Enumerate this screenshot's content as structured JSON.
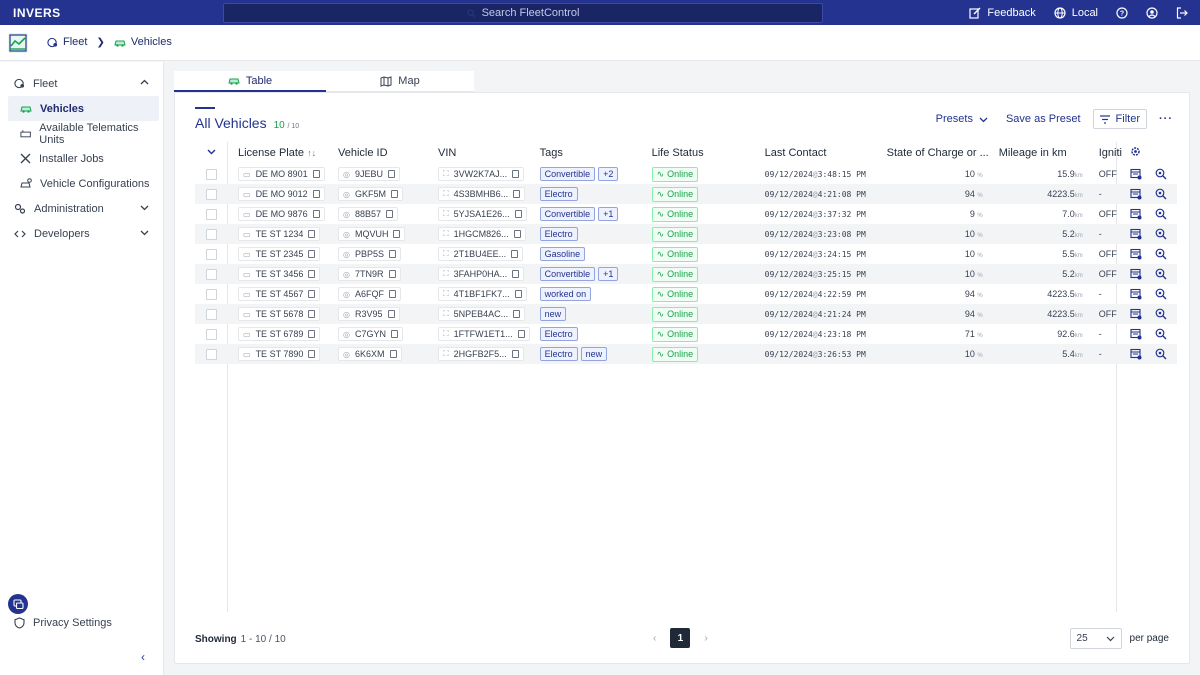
{
  "topbar": {
    "logo": "INVERS",
    "search_placeholder": "Search FleetControl",
    "feedback": "Feedback",
    "locale": "Local"
  },
  "breadcrumb": {
    "fleet": "Fleet",
    "vehicles": "Vehicles"
  },
  "sidebar": {
    "fleet": "Fleet",
    "items": [
      "Vehicles",
      "Available Telematics Units",
      "Installer Jobs",
      "Vehicle Configurations"
    ],
    "administration": "Administration",
    "developers": "Developers",
    "privacy": "Privacy Settings"
  },
  "tabs": {
    "table": "Table",
    "map": "Map"
  },
  "list": {
    "title": "All Vehicles",
    "count": "10",
    "total": "/ 10",
    "presets": "Presets",
    "save_preset": "Save as Preset",
    "filter": "Filter",
    "more": "···"
  },
  "columns": {
    "license_plate": "License Plate",
    "vehicle_id": "Vehicle ID",
    "vin": "VIN",
    "tags": "Tags",
    "life_status": "Life Status",
    "last_contact": "Last Contact",
    "soc": "State of Charge or ...",
    "mileage": "Mileage in km",
    "ignition": "Igniti"
  },
  "rows": [
    {
      "plate": "DE MO 8901",
      "vid": "9JEBU",
      "vin": "3VW2K7AJ...",
      "tags": [
        "Convertible",
        "+2"
      ],
      "status": "Online",
      "contact": "09/12/2024@3:48:15 PM",
      "soc": "10",
      "mileage": "15.9",
      "ign": "OFF"
    },
    {
      "plate": "DE MO 9012",
      "vid": "GKF5M",
      "vin": "4S3BMHB6...",
      "tags": [
        "Electro"
      ],
      "status": "Online",
      "contact": "09/12/2024@4:21:08 PM",
      "soc": "94",
      "mileage": "4223.5",
      "ign": "-"
    },
    {
      "plate": "DE MO 9876",
      "vid": "88B57",
      "vin": "5YJSA1E26...",
      "tags": [
        "Convertible",
        "+1"
      ],
      "status": "Online",
      "contact": "09/12/2024@3:37:32 PM",
      "soc": "9",
      "mileage": "7.0",
      "ign": "OFF"
    },
    {
      "plate": "TE ST 1234",
      "vid": "MQVUH",
      "vin": "1HGCM826...",
      "tags": [
        "Electro"
      ],
      "status": "Online",
      "contact": "09/12/2024@3:23:08 PM",
      "soc": "10",
      "mileage": "5.2",
      "ign": "-"
    },
    {
      "plate": "TE ST 2345",
      "vid": "PBP5S",
      "vin": "2T1BU4EE...",
      "tags": [
        "Gasoline"
      ],
      "status": "Online",
      "contact": "09/12/2024@3:24:15 PM",
      "soc": "10",
      "mileage": "5.5",
      "ign": "OFF"
    },
    {
      "plate": "TE ST 3456",
      "vid": "7TN9R",
      "vin": "3FAHP0HA...",
      "tags": [
        "Convertible",
        "+1"
      ],
      "status": "Online",
      "contact": "09/12/2024@3:25:15 PM",
      "soc": "10",
      "mileage": "5.2",
      "ign": "OFF"
    },
    {
      "plate": "TE ST 4567",
      "vid": "A6FQF",
      "vin": "4T1BF1FK7...",
      "tags": [
        "worked on"
      ],
      "status": "Online",
      "contact": "09/12/2024@4:22:59 PM",
      "soc": "94",
      "mileage": "4223.5",
      "ign": "-"
    },
    {
      "plate": "TE ST 5678",
      "vid": "R3V95",
      "vin": "5NPEB4AC...",
      "tags": [
        "new"
      ],
      "status": "Online",
      "contact": "09/12/2024@4:21:24 PM",
      "soc": "94",
      "mileage": "4223.5",
      "ign": "OFF"
    },
    {
      "plate": "TE ST 6789",
      "vid": "C7GYN",
      "vin": "1FTFW1ET1...",
      "tags": [
        "Electro"
      ],
      "status": "Online",
      "contact": "09/12/2024@4:23:18 PM",
      "soc": "71",
      "mileage": "92.6",
      "ign": "-"
    },
    {
      "plate": "TE ST 7890",
      "vid": "6K6XM",
      "vin": "2HGFB2F5...",
      "tags": [
        "Electro",
        "new"
      ],
      "status": "Online",
      "contact": "09/12/2024@3:26:53 PM",
      "soc": "10",
      "mileage": "5.4",
      "ign": "-"
    }
  ],
  "units": {
    "soc": "%",
    "mileage": "km"
  },
  "footer": {
    "showing": "Showing",
    "range": "1 - 10 / 10",
    "prev": "‹",
    "page": "1",
    "next": "›",
    "per_page_value": "25",
    "per_page": "per page"
  }
}
